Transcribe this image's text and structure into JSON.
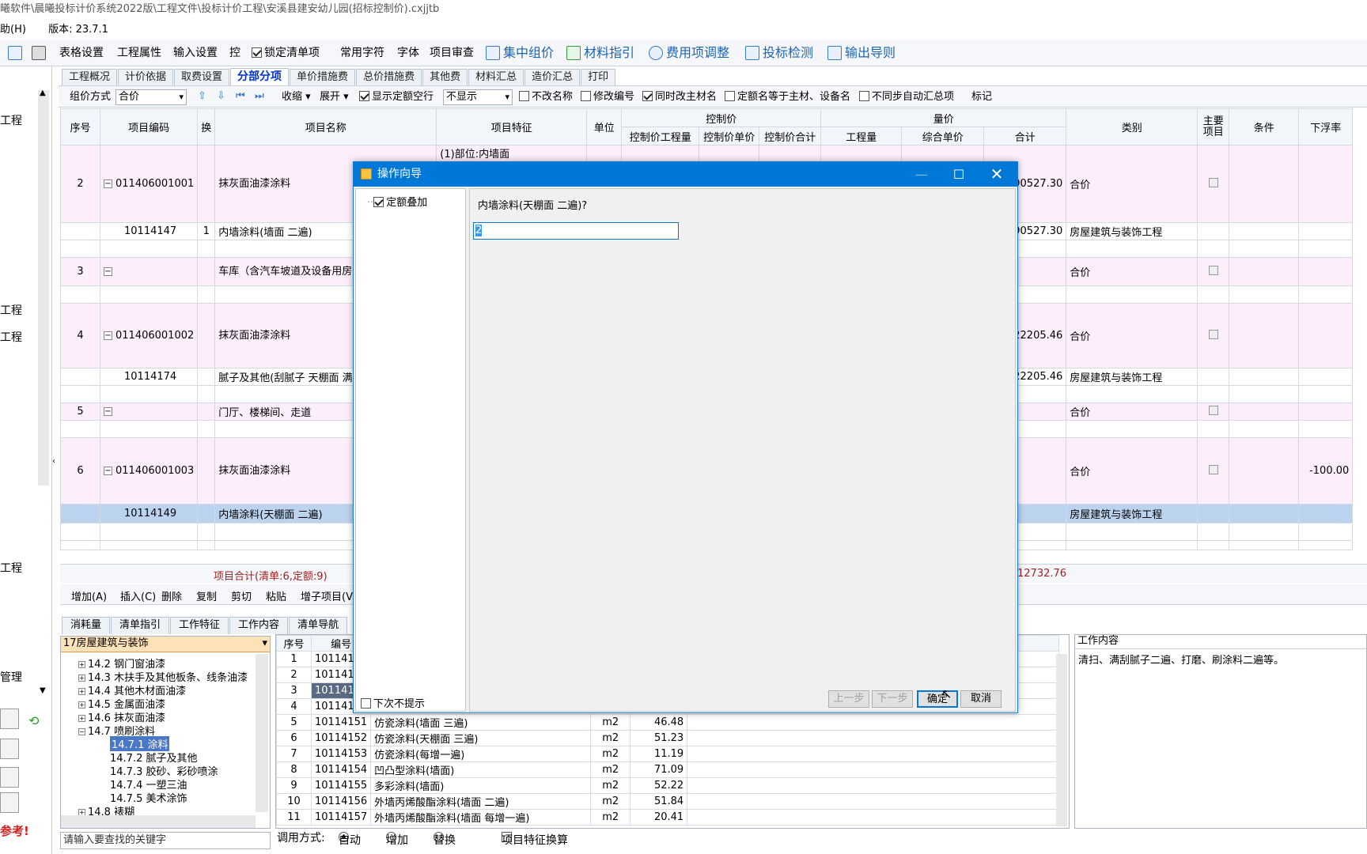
{
  "window": {
    "title": "曦软件\\晨曦投标计价系统2022版\\工程文件\\投标计价工程\\安溪县建安幼儿园(招标控制价).cxjjtb"
  },
  "menu": {
    "help": "助(H)",
    "version": "版本: 23.7.1"
  },
  "toolbar": {
    "table_settings": "表格设置",
    "project_props": "工程属性",
    "input_settings": "输入设置",
    "control": "控",
    "lock_list": "锁定清单项",
    "common_chars": "常用字符",
    "font": "字体",
    "project_review": "项目审查",
    "central_pricing": "集中组价",
    "material_guide": "材料指引",
    "fee_adjust": "费用项调整",
    "bid_check": "投标检测",
    "export_guide": "输出导则"
  },
  "left_panel": {
    "labels": [
      "工程",
      "工程",
      "工程",
      "工程",
      "管理"
    ],
    "warning": "参考!"
  },
  "tabs": [
    "工程概况",
    "计价依据",
    "取费设置",
    "分部分项",
    "单价措施费",
    "总价措施费",
    "其他费",
    "材料汇总",
    "造价汇总",
    "打印"
  ],
  "active_tab": "分部分项",
  "subbar": {
    "pricing_mode_label": "组价方式",
    "pricing_mode_value": "合价",
    "collapse": "收缩",
    "expand": "展开",
    "show_empty_rows": "显示定额空行",
    "show_mode_value": "不显示",
    "no_rename": "不改名称",
    "edit_code": "修改编号",
    "sync_main_material": "同时改主材名",
    "quota_equal_main": "定额名等于主材、设备名",
    "no_sync_summary": "不同步自动汇总项",
    "mark": "标记"
  },
  "grid": {
    "headers": {
      "seq": "序号",
      "code": "项目编码",
      "swap": "换",
      "name": "项目名称",
      "feature": "项目特征",
      "unit": "单位",
      "control_price": "控制价",
      "quantity_price": "量价",
      "cp_qty": "控制价工程量",
      "cp_unit": "控制价单价",
      "cp_total": "控制价合计",
      "qty": "工程量",
      "unit_price": "综合单价",
      "total": "合计",
      "category": "类别",
      "main_item": "主要项目",
      "condition": "条件",
      "float_rate": "下浮率"
    },
    "rows": [
      {
        "seq": "2",
        "code": "011406001001",
        "swap": "",
        "name": "抹灰面油漆涂料",
        "feature": "(1)部位:内墙面",
        "total": "90527.30",
        "category": "合价",
        "float": "",
        "type": "pink",
        "h": 98,
        "exp": true
      },
      {
        "seq": "",
        "code": "10114147",
        "swap": "1",
        "name": "内墙涂料(墙面 二遍)",
        "feature": "",
        "total": "90527.30",
        "category": "房屋建筑与装饰工程",
        "float": "",
        "type": "white",
        "h": 22,
        "exp": false
      },
      {
        "seq": "",
        "code": "",
        "swap": "",
        "name": "",
        "feature": "",
        "total": "",
        "category": "",
        "float": "",
        "type": "white",
        "h": 22,
        "exp": false
      },
      {
        "seq": "3",
        "code": "",
        "swap": "",
        "name": "车库（含汽车坡道及设备用房）制室",
        "feature": "",
        "total": "",
        "category": "合价",
        "float": "",
        "type": "pink",
        "h": 36,
        "exp": true
      },
      {
        "seq": "",
        "code": "",
        "swap": "",
        "name": "",
        "feature": "",
        "total": "",
        "category": "",
        "float": "",
        "type": "white",
        "h": 22,
        "exp": false
      },
      {
        "seq": "4",
        "code": "011406001002",
        "swap": "",
        "name": "抹灰面油漆涂料",
        "feature": "",
        "total": "22205.46",
        "category": "合价",
        "float": "",
        "type": "pink",
        "h": 82,
        "exp": true
      },
      {
        "seq": "",
        "code": "10114174",
        "swap": "",
        "name": "腻子及其他(刮腻子 天棚面 满刮",
        "feature": "",
        "total": "22205.46",
        "category": "房屋建筑与装饰工程",
        "float": "",
        "type": "white",
        "h": 22,
        "exp": false
      },
      {
        "seq": "",
        "code": "",
        "swap": "",
        "name": "",
        "feature": "",
        "total": "",
        "category": "",
        "float": "",
        "type": "white",
        "h": 22,
        "exp": false
      },
      {
        "seq": "5",
        "code": "",
        "swap": "",
        "name": "门厅、楼梯间、走道",
        "feature": "",
        "total": "",
        "category": "合价",
        "float": "",
        "type": "pink",
        "h": 22,
        "exp": true
      },
      {
        "seq": "",
        "code": "",
        "swap": "",
        "name": "",
        "feature": "",
        "total": "",
        "category": "",
        "float": "",
        "type": "white",
        "h": 22,
        "exp": false
      },
      {
        "seq": "6",
        "code": "011406001003",
        "swap": "",
        "name": "抹灰面油漆涂料",
        "feature": "",
        "total": "",
        "category": "合价",
        "float": "-100.00",
        "type": "pink",
        "h": 84,
        "exp": true
      },
      {
        "seq": "",
        "code": "10114149",
        "swap": "",
        "name": "内墙涂料(天棚面 二遍)",
        "feature": "",
        "total": "",
        "category": "房屋建筑与装饰工程",
        "float": "",
        "type": "sel",
        "h": 24,
        "exp": false
      },
      {
        "seq": "",
        "code": "",
        "swap": "",
        "name": "",
        "feature": "",
        "total": "",
        "category": "",
        "float": "",
        "type": "white",
        "h": 22,
        "exp": false
      },
      {
        "seq": "",
        "code": "",
        "swap": "",
        "name": "",
        "feature": "",
        "total": "",
        "category": "",
        "float": "",
        "type": "white",
        "h": 12,
        "exp": false
      }
    ]
  },
  "summary": {
    "label": "项目合计(清单:6,定额:9)",
    "total": "12732.76"
  },
  "actions": [
    "增加(A)",
    "插入(C)",
    "删除",
    "复制",
    "剪切",
    "粘贴",
    "增子项目(V)"
  ],
  "bottom_tabs": [
    "消耗量",
    "清单指引",
    "工作特征",
    "工作内容",
    "清单导航"
  ],
  "tree": {
    "selected_category": "17房屋建筑与装饰",
    "nodes": [
      "14.2 钢门窗油漆",
      "14.3 木扶手及其他板条、线条油漆",
      "14.4 其他木材面油漆",
      "14.5 金属面油漆",
      "14.6 抹灰面油漆",
      "14.7 喷刷涂料",
      "14.7.1 涂料",
      "14.7.2 腻子及其他",
      "14.7.3 胶砂、彩砂喷涂",
      "14.7.4 一塑三油",
      "14.7.5 美术涂饰",
      "14.8 裱糊"
    ],
    "search_placeholder": "请输入要查找的关键字"
  },
  "quota_list": {
    "headers": {
      "seq": "序号",
      "code": "编号"
    },
    "rows": [
      {
        "seq": "1",
        "code": "101141",
        "name": "",
        "unit": "",
        "price": ""
      },
      {
        "seq": "2",
        "code": "101141",
        "name": "",
        "unit": "",
        "price": ""
      },
      {
        "seq": "3",
        "code": "101141",
        "name": "",
        "unit": "",
        "price": ""
      },
      {
        "seq": "4",
        "code": "101141",
        "name": "",
        "unit": "",
        "price": ""
      },
      {
        "seq": "5",
        "code": "10114151",
        "name": "仿瓷涂料(墙面 三遍)",
        "unit": "m2",
        "price": "46.48"
      },
      {
        "seq": "6",
        "code": "10114152",
        "name": "仿瓷涂料(天棚面 三遍)",
        "unit": "m2",
        "price": "51.23"
      },
      {
        "seq": "7",
        "code": "10114153",
        "name": "仿瓷涂料(每增一遍)",
        "unit": "m2",
        "price": "11.19"
      },
      {
        "seq": "8",
        "code": "10114154",
        "name": "凹凸型涂料(墙面)",
        "unit": "m2",
        "price": "71.09"
      },
      {
        "seq": "9",
        "code": "10114155",
        "name": "多彩涂料(墙面)",
        "unit": "m2",
        "price": "52.22"
      },
      {
        "seq": "10",
        "code": "10114156",
        "name": "外墙丙烯酸酯涂料(墙面 二遍)",
        "unit": "m2",
        "price": "51.84"
      },
      {
        "seq": "11",
        "code": "10114157",
        "name": "外墙丙烯酸酯涂料(墙面 每增一遍)",
        "unit": "m2",
        "price": "20.41"
      }
    ]
  },
  "work_content": {
    "title": "工作内容",
    "text": "清扫、满刮腻子二遍、打磨、刷涂料二遍等。"
  },
  "call_mode": {
    "label": "调用方式:",
    "auto": "自动",
    "add": "增加",
    "replace": "替换",
    "feature_convert": "项目特征换算"
  },
  "dialog": {
    "title": "操作向导",
    "tree_item": "定额叠加",
    "question": "内墙涂料(天棚面 二遍)?",
    "input_value": "2",
    "no_prompt": "下次不提示",
    "prev": "上一步",
    "next": "下一步",
    "ok": "确定",
    "cancel": "取消"
  }
}
